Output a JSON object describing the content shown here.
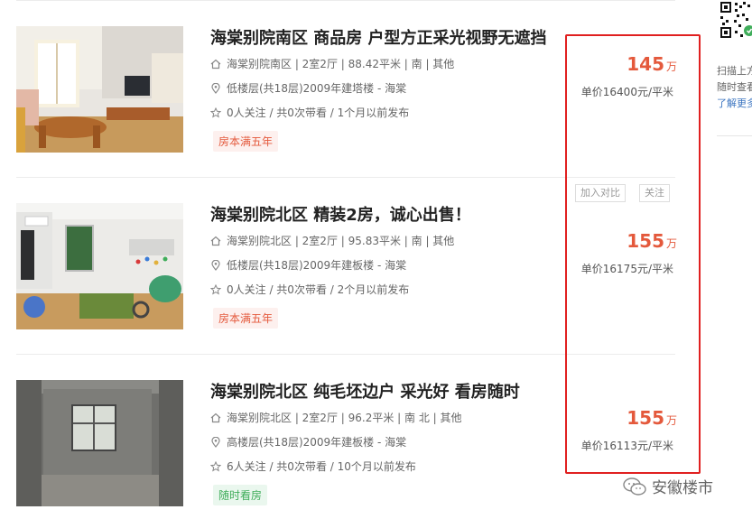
{
  "listings": [
    {
      "title": "海棠别院南区 商品房 户型方正采光视野无遮挡",
      "info": "海棠别院南区 | 2室2厅 | 88.42平米 | 南 | 其他",
      "floor": "低楼层(共18层)2009年建塔楼 - 海棠",
      "follow": "0人关注 / 共0次带看 / 1个月以前发布",
      "tag": "房本满五年",
      "tag_color": "#e4593c",
      "price": "145",
      "price_unit": "万",
      "unit_price": "单价16400元/平米"
    },
    {
      "title": "海棠别院北区 精装2房，诚心出售！",
      "info": "海棠别院北区 | 2室2厅 | 95.83平米 | 南 | 其他",
      "floor": "低楼层(共18层)2009年建板楼 - 海棠",
      "follow": "0人关注 / 共0次带看 / 2个月以前发布",
      "tag": "房本满五年",
      "tag_color": "#e4593c",
      "price": "155",
      "price_unit": "万",
      "unit_price": "单价16175元/平米"
    },
    {
      "title": "海棠别院北区 纯毛坯边户 采光好 看房随时",
      "info": "海棠别院北区 | 2室2厅 | 96.2平米 | 南 北 | 其他",
      "floor": "高楼层(共18层)2009年建板楼 - 海棠",
      "follow": "6人关注 / 共0次带看 / 10个月以前发布",
      "tag": "随时看房",
      "tag_color": "#3fad5a",
      "price": "155",
      "price_unit": "万",
      "unit_price": "单价16113元/平米"
    }
  ],
  "actions": {
    "compare": "加入对比",
    "follow": "关注"
  },
  "sidebar": {
    "scan_line1": "扫描上方",
    "scan_line2": "随时查看",
    "learn_more": "了解更多"
  },
  "watermark": "安徽楼市",
  "colors": {
    "price": "#e4593c",
    "highlight_border": "#e02020",
    "link": "#3a74c0"
  },
  "icons": [
    "home-icon",
    "location-pin-icon",
    "star-icon",
    "qr-code-icon",
    "wechat-logo-icon"
  ]
}
